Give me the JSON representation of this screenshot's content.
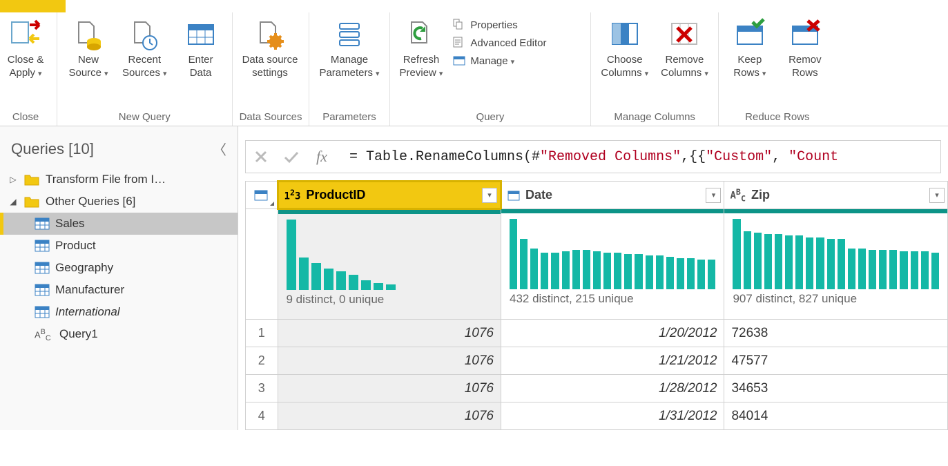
{
  "ribbon": {
    "groups": {
      "close": {
        "label": "Close",
        "close_apply": "Close &\nApply"
      },
      "newq": {
        "label": "New Query",
        "new_source": "New\nSource",
        "recent": "Recent\nSources",
        "enter": "Enter\nData"
      },
      "datasrc": {
        "label": "Data Sources",
        "settings": "Data source\nsettings"
      },
      "params": {
        "label": "Parameters",
        "manage": "Manage\nParameters"
      },
      "query": {
        "label": "Query",
        "refresh": "Refresh\nPreview",
        "props": "Properties",
        "adv": "Advanced Editor",
        "manage": "Manage"
      },
      "mcols": {
        "label": "Manage Columns",
        "choose": "Choose\nColumns",
        "remove": "Remove\nColumns"
      },
      "rrows": {
        "label": "Reduce Rows",
        "keep": "Keep\nRows",
        "remove": "Remov\nRows"
      }
    }
  },
  "queries": {
    "header": "Queries [10]",
    "tree": [
      {
        "kind": "folder",
        "expand": "closed",
        "label": "Transform File from I…"
      },
      {
        "kind": "folder",
        "expand": "open",
        "label": "Other Queries [6]"
      },
      {
        "kind": "table",
        "label": "Sales",
        "selected": true
      },
      {
        "kind": "table",
        "label": "Product"
      },
      {
        "kind": "table",
        "label": "Geography"
      },
      {
        "kind": "table",
        "label": "Manufacturer"
      },
      {
        "kind": "table",
        "label": "International",
        "italic": true
      },
      {
        "kind": "abc",
        "label": "Query1"
      }
    ]
  },
  "formula": {
    "pre": "= Table.RenameColumns(#",
    "s1": "\"Removed Columns\"",
    "mid": ",{{",
    "s2": "\"Custom\"",
    "mid2": ", ",
    "s3": "\"Count",
    "post": ""
  },
  "columns": [
    {
      "name": "ProductID",
      "type": "123",
      "selected": true,
      "profile": "9 distinct, 0 unique"
    },
    {
      "name": "Date",
      "type": "cal",
      "selected": false,
      "profile": "432 distinct, 215 unique"
    },
    {
      "name": "Zip",
      "type": "ABC",
      "selected": false,
      "profile": "907 distinct, 827 unique"
    }
  ],
  "chart_data": [
    {
      "type": "bar",
      "title": "ProductID distribution",
      "xlabel": "",
      "ylabel": "",
      "ylim": [
        0,
        100
      ],
      "categories": [
        "1",
        "2",
        "3",
        "4",
        "5",
        "6",
        "7",
        "8",
        "9"
      ],
      "values": [
        100,
        46,
        38,
        30,
        26,
        22,
        14,
        10,
        8
      ]
    },
    {
      "type": "bar",
      "title": "Date distribution",
      "xlabel": "",
      "ylabel": "",
      "ylim": [
        0,
        100
      ],
      "categories": [
        "1",
        "2",
        "3",
        "4",
        "5",
        "6",
        "7",
        "8",
        "9",
        "10",
        "11",
        "12",
        "13",
        "14",
        "15",
        "16",
        "17",
        "18",
        "19",
        "20"
      ],
      "values": [
        100,
        72,
        58,
        52,
        52,
        54,
        56,
        56,
        54,
        52,
        52,
        50,
        50,
        48,
        48,
        46,
        44,
        44,
        42,
        42
      ]
    },
    {
      "type": "bar",
      "title": "Zip distribution",
      "xlabel": "",
      "ylabel": "",
      "ylim": [
        0,
        100
      ],
      "categories": [
        "1",
        "2",
        "3",
        "4",
        "5",
        "6",
        "7",
        "8",
        "9",
        "10",
        "11",
        "12",
        "13",
        "14",
        "15",
        "16",
        "17",
        "18",
        "19",
        "20"
      ],
      "values": [
        100,
        82,
        80,
        78,
        78,
        76,
        76,
        74,
        74,
        72,
        72,
        58,
        58,
        56,
        56,
        56,
        54,
        54,
        54,
        52
      ]
    }
  ],
  "rows": [
    {
      "n": "1",
      "ProductID": "1076",
      "Date": "1/20/2012",
      "Zip": "72638"
    },
    {
      "n": "2",
      "ProductID": "1076",
      "Date": "1/21/2012",
      "Zip": "47577"
    },
    {
      "n": "3",
      "ProductID": "1076",
      "Date": "1/28/2012",
      "Zip": "34653"
    },
    {
      "n": "4",
      "ProductID": "1076",
      "Date": "1/31/2012",
      "Zip": "84014"
    }
  ]
}
